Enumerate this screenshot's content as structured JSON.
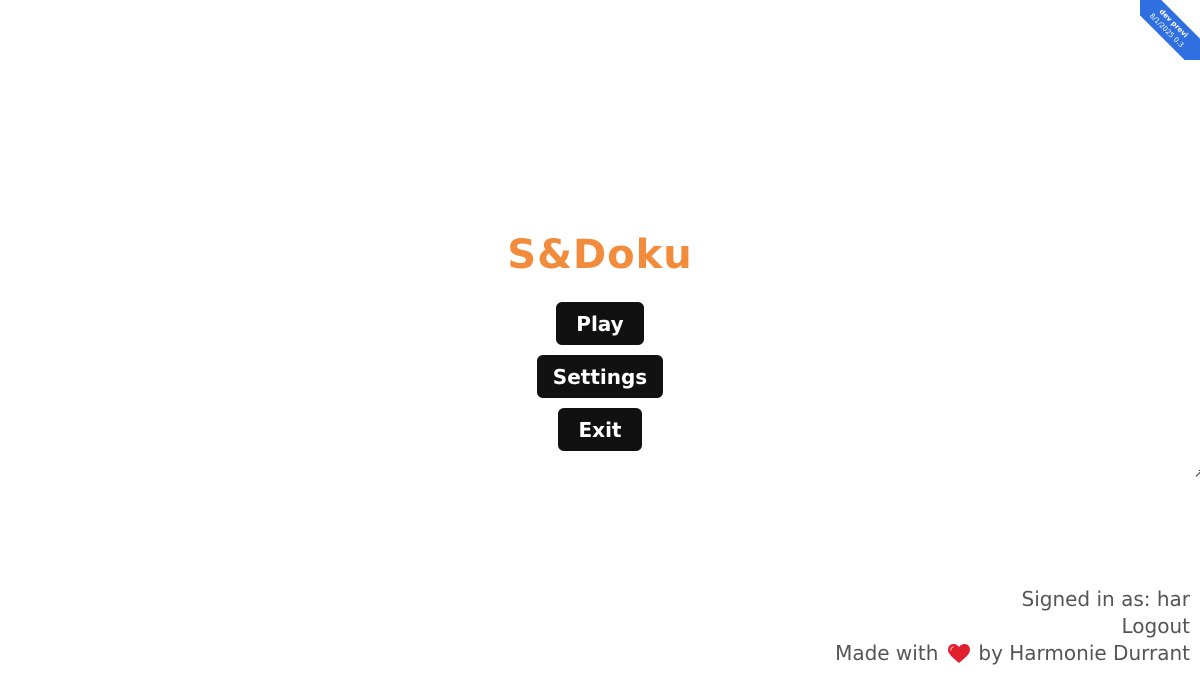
{
  "app": {
    "title": "S&Doku",
    "accent_color": "#f28c3c"
  },
  "menu": {
    "play_label": "Play",
    "settings_label": "Settings",
    "exit_label": "Exit"
  },
  "footer": {
    "signed_in_label": "Signed in as: har",
    "logout_label": "Logout",
    "made_with_label": "Made with",
    "heart_icon": "heart-icon",
    "by_label": "by Harmonie Durrant"
  },
  "ribbon": {
    "line1": "dev previ",
    "line2": "8/1/2025 0.3",
    "color": "#2f6fe0"
  }
}
